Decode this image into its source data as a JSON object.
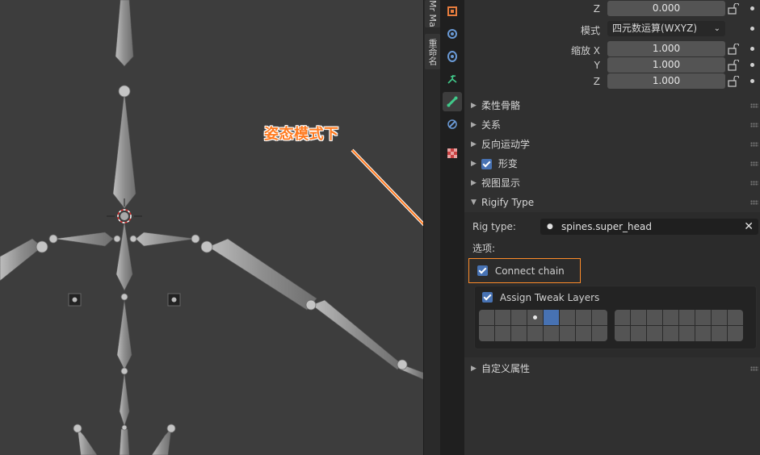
{
  "viewport": {
    "annotation": "姿态模式下"
  },
  "addon_tabs": {
    "items": [
      "Mr Ma",
      "重命名"
    ]
  },
  "transform": {
    "z_top": {
      "label": "Z",
      "value": "0.000"
    },
    "mode": {
      "label": "模式",
      "value": "四元数运算(WXYZ)"
    },
    "scale_x": {
      "label": "缩放 X",
      "value": "1.000"
    },
    "scale_y": {
      "label": "Y",
      "value": "1.000"
    },
    "scale_z": {
      "label": "Z",
      "value": "1.000"
    }
  },
  "panels": {
    "bendy_bones": "柔性骨骼",
    "relations": "关系",
    "inverse_kinematics": "反向运动学",
    "deform": "形变",
    "viewport_display": "视图显示",
    "rigify_type": "Rigify Type",
    "custom_props": "自定义属性"
  },
  "rigify": {
    "rig_type_label": "Rig type:",
    "rig_type_value": "spines.super_head",
    "options_label": "选项:",
    "connect_chain": "Connect chain",
    "assign_tweak_layers": "Assign Tweak Layers",
    "active_layer_index": 4,
    "dot_layer_index": 3
  },
  "colors": {
    "accent_blue": "#4772b3",
    "annotation_orange": "#ff7a1f"
  }
}
